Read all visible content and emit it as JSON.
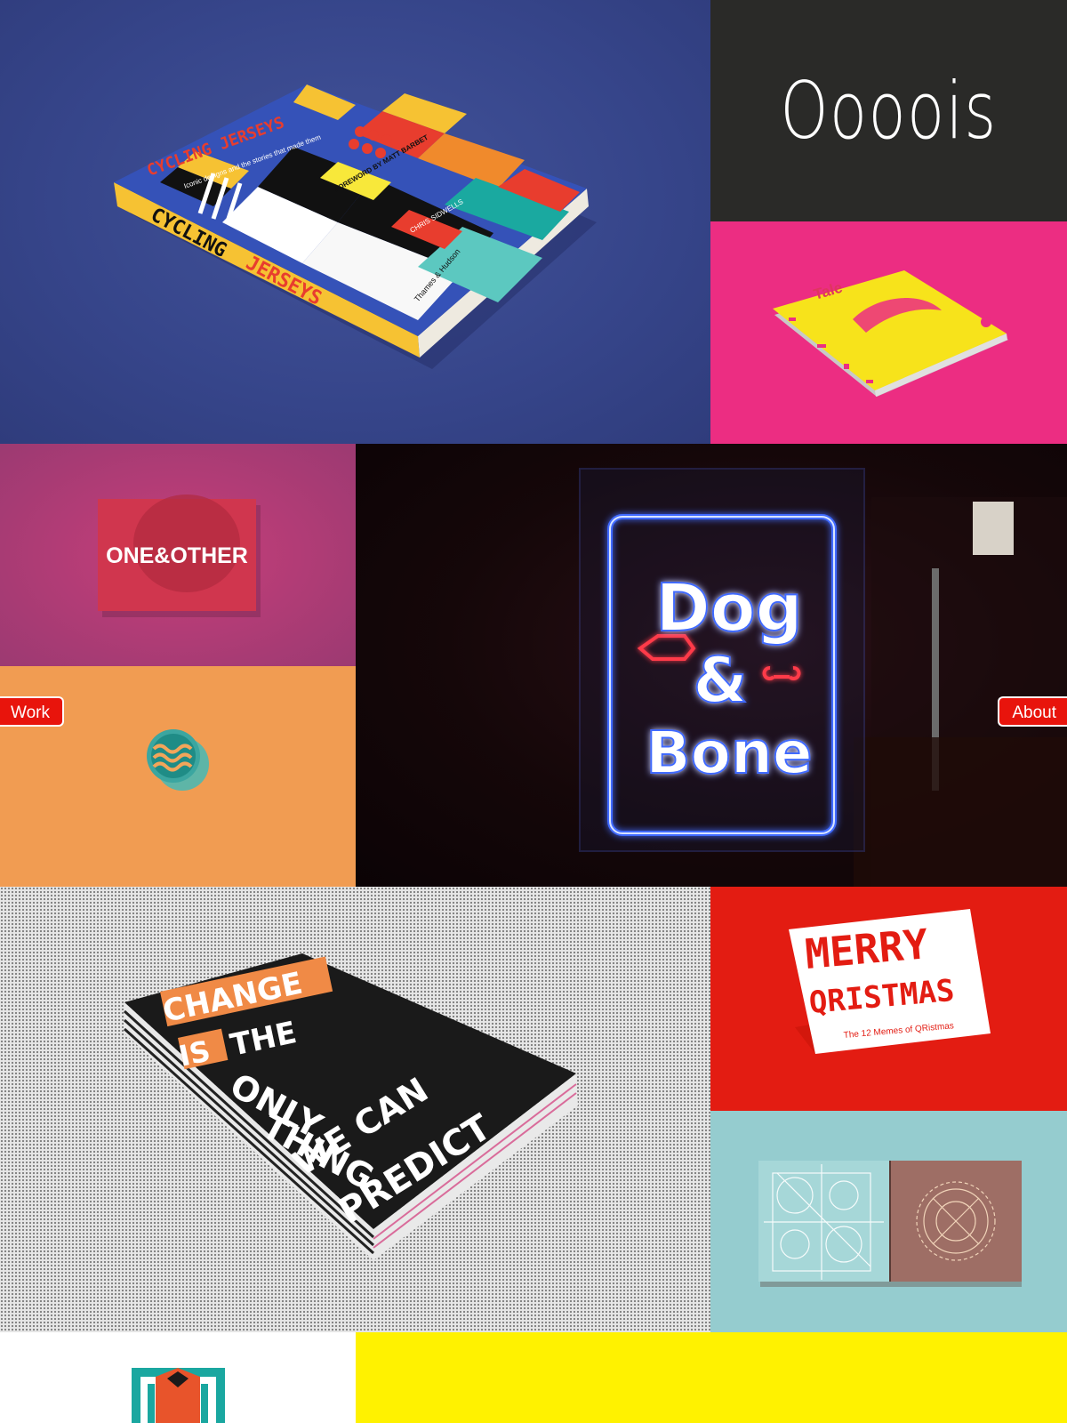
{
  "site": {
    "logo_text": "Oooois"
  },
  "nav": {
    "work_label": "Work",
    "about_label": "About"
  },
  "projects": {
    "cycling": {
      "title_top": "CYCLING JERSEYS",
      "tagline": "Iconic designs and the stories that made them",
      "spine_line1": "CYCLING",
      "spine_line2": "JERSEYS",
      "foreword": "FOREWORD BY MATT BARBET",
      "author": "CHRIS SIDWELLS",
      "publisher": "Thames & Hudson"
    },
    "tale": {
      "title": "Tale"
    },
    "one_other": {
      "title": "ONE&OTHER"
    },
    "dog_bone": {
      "line1": "Dog",
      "line2": "&",
      "line3": "Bone"
    },
    "change": {
      "line1": "CHANGE",
      "line2a": "IS",
      "line2b": "THE",
      "line3": "ONLY",
      "line4": "THING",
      "line5": "WE CAN",
      "line6": "PREDICT"
    },
    "merry": {
      "line1": "MERRY",
      "line2": "QRISTMAS",
      "subtitle": "The 12 Memes of QRistmas"
    }
  },
  "colors": {
    "cycling_bg": "#36458a",
    "logo_bg": "#2a2a28",
    "tale_bg": "#ec2d82",
    "one_bg": "#a83b74",
    "dog_bg": "#150709",
    "orange_bg": "#f19c52",
    "merry_bg": "#e31c12",
    "teal_bg": "#95cccf",
    "yellow_bg": "#fff200",
    "nav_red": "#e8140c"
  }
}
